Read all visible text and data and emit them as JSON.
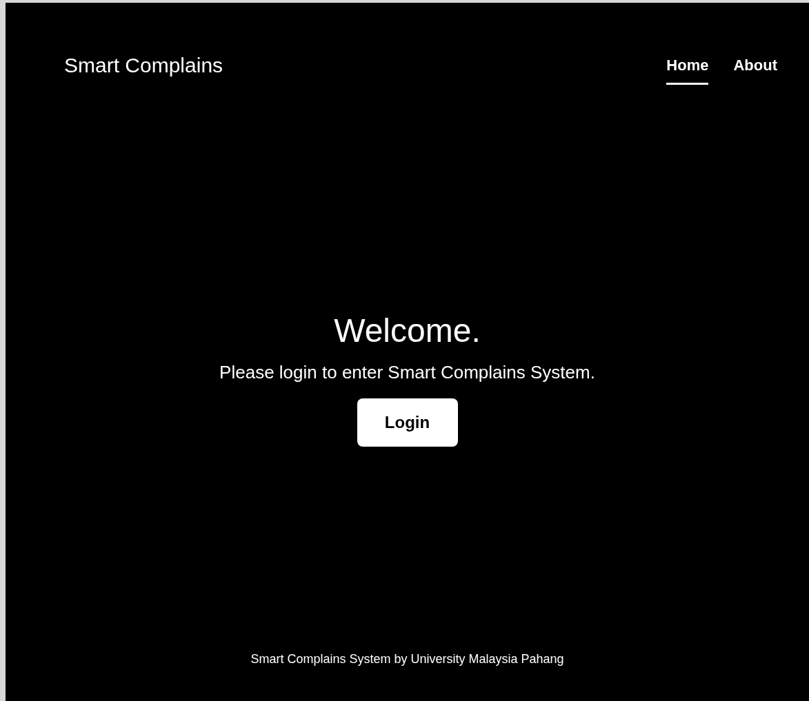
{
  "header": {
    "brand": "Smart Complains"
  },
  "nav": [
    {
      "label": "Home",
      "selected": true
    },
    {
      "label": "About",
      "selected": false
    }
  ],
  "hero": {
    "title": "Welcome.",
    "subtitle": "Please login to enter Smart Complains System.",
    "button": "Login"
  },
  "footer": {
    "text": "Smart Complains System by University Malaysia Pahang"
  }
}
